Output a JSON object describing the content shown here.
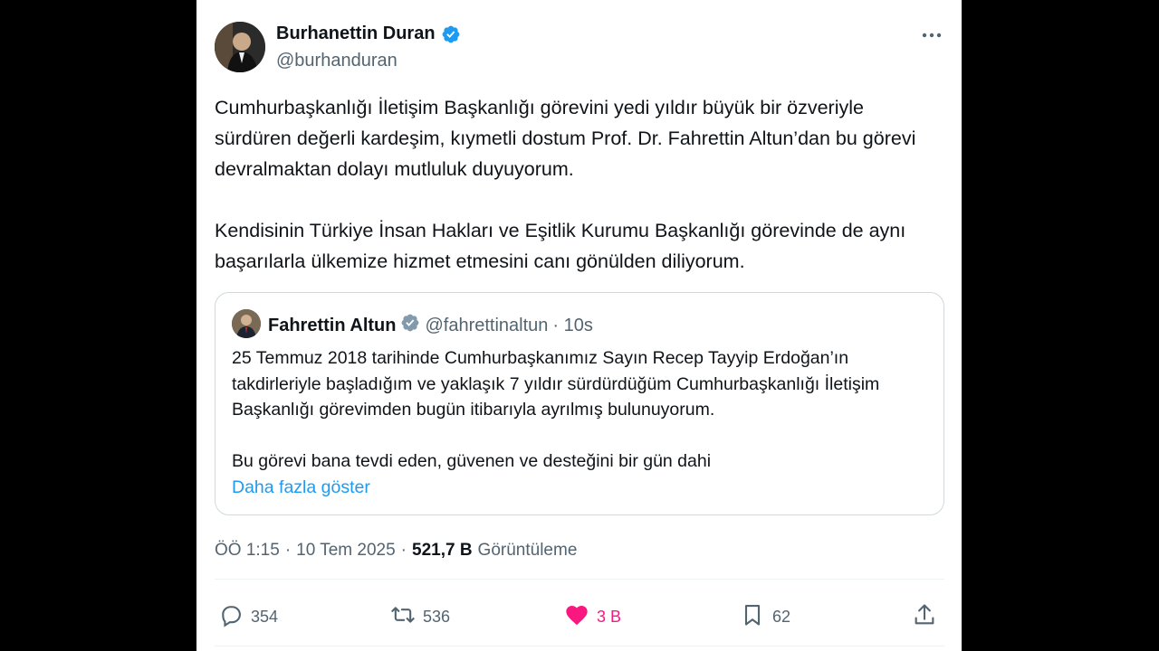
{
  "author": {
    "name": "Burhanettin Duran",
    "handle": "@burhanduran"
  },
  "tweet": {
    "paragraphs": [
      "Cumhurbaşkanlığı İletişim Başkanlığı görevini yedi yıldır büyük bir özveriyle sürdüren değerli kardeşim, kıymetli dostum Prof. Dr. Fahrettin Altun’dan bu görevi devralmaktan dolayı mutluluk duyuyorum.",
      "Kendisinin Türkiye İnsan Hakları ve Eşitlik Kurumu Başkanlığı görevinde de aynı başarılarla ülkemize hizmet etmesini canı gönülden diliyorum."
    ]
  },
  "quote": {
    "name": "Fahrettin Altun",
    "handle": "@fahrettinaltun",
    "time": "· 10s",
    "paragraphs": [
      "25 Temmuz 2018 tarihinde Cumhurbaşkanımız Sayın Recep Tayyip Erdoğan’ın takdirleriyle başladığım ve yaklaşık 7 yıldır sürdürdüğüm Cumhurbaşkanlığı İletişim Başkanlığı görevimden bugün itibarıyla ayrılmış bulunuyorum.",
      "Bu görevi bana tevdi eden, güvenen ve desteğini bir gün dahi"
    ],
    "show_more": "Daha fazla göster"
  },
  "meta": {
    "time": "ÖÖ 1:15",
    "date": "10 Tem 2025",
    "views_count": "521,7 B",
    "views_label": "Görüntüleme"
  },
  "actions": {
    "replies": "354",
    "reposts": "536",
    "likes": "3 B",
    "bookmarks": "62"
  },
  "colors": {
    "verified": "#1d9bf0",
    "like": "#f91880",
    "link": "#1d9bf0"
  },
  "icons": [
    "verified-badge-icon",
    "more-icon",
    "reply-icon",
    "repost-icon",
    "heart-icon",
    "bookmark-icon",
    "share-icon"
  ]
}
